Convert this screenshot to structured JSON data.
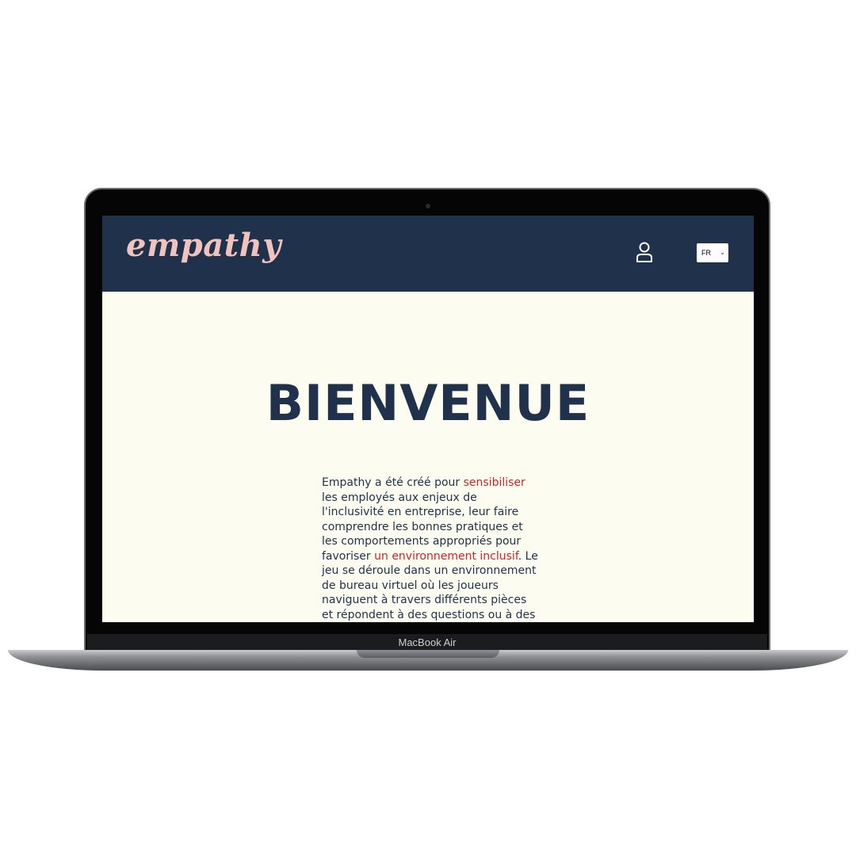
{
  "device": {
    "label": "MacBook Air"
  },
  "site": {
    "logo_text": "empathy",
    "profile_icon": "user-icon",
    "language": {
      "selected": "FR",
      "chevron_icon": "chevron-down-icon"
    }
  },
  "hero": {
    "title": "BIENVENUE"
  },
  "intro": {
    "part1": "Empathy a été créé pour ",
    "highlight1": "sensibiliser",
    "part2": " les employés aux enjeux de l'inclusivité en entreprise, leur faire comprendre les bonnes pratiques et les comportements appropriés pour favoriser ",
    "highlight2": "un environnement inclusif",
    "part3": ". Le jeu se déroule dans un environnement de bureau virtuel où les joueurs naviguent à travers différents pièces et répondent à des questions ou à des"
  },
  "colors": {
    "header_bg": "#1f314b",
    "page_bg": "#fdfcf0",
    "logo": "#f2c3bd",
    "title": "#1f314b",
    "accent": "#c8262b"
  }
}
